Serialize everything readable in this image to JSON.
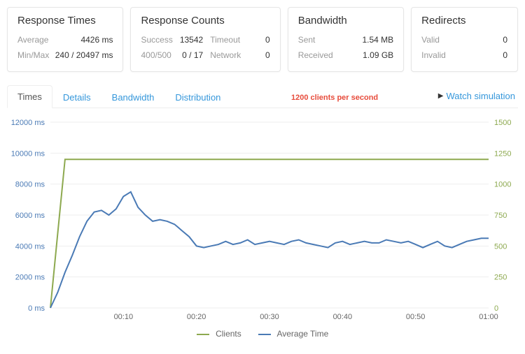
{
  "cards": {
    "response_times": {
      "title": "Response Times",
      "rows": [
        {
          "k": "Average",
          "v": "4426 ms"
        },
        {
          "k": "Min/Max",
          "v": "240 / 20497 ms"
        }
      ]
    },
    "response_counts": {
      "title": "Response Counts",
      "cells": {
        "success_k": "Success",
        "success_v": "13542",
        "timeout_k": "Timeout",
        "timeout_v": "0",
        "status_k": "400/500",
        "status_v": "0 / 17",
        "network_k": "Network",
        "network_v": "0"
      }
    },
    "bandwidth": {
      "title": "Bandwidth",
      "rows": [
        {
          "k": "Sent",
          "v": "1.54 MB"
        },
        {
          "k": "Received",
          "v": "1.09 GB"
        }
      ]
    },
    "redirects": {
      "title": "Redirects",
      "rows": [
        {
          "k": "Valid",
          "v": "0"
        },
        {
          "k": "Invalid",
          "v": "0"
        }
      ]
    }
  },
  "tabs": {
    "times": "Times",
    "details": "Details",
    "bandwidth": "Bandwidth",
    "distribution": "Distribution"
  },
  "banner": "1200 clients per second",
  "watch": "Watch simulation",
  "legend": {
    "clients": "Clients",
    "avg": "Average Time"
  },
  "chart_data": {
    "type": "line",
    "x_unit": "seconds",
    "x_ticks": [
      "00:10",
      "00:20",
      "00:30",
      "00:40",
      "00:50",
      "01:00"
    ],
    "left_axis": {
      "label": "ms",
      "ticks": [
        0,
        2000,
        4000,
        6000,
        8000,
        10000,
        12000
      ],
      "range": [
        0,
        12000
      ]
    },
    "right_axis": {
      "label": "",
      "ticks": [
        0,
        250,
        500,
        750,
        1000,
        1250,
        1500
      ],
      "range": [
        0,
        1500
      ]
    },
    "series": [
      {
        "name": "Clients",
        "axis": "right",
        "points": [
          {
            "x": 0,
            "y": 0
          },
          {
            "x": 1,
            "y": 600
          },
          {
            "x": 2,
            "y": 1200
          },
          {
            "x": 3,
            "y": 1200
          },
          {
            "x": 60,
            "y": 1200
          }
        ]
      },
      {
        "name": "Average Time",
        "axis": "left",
        "points": [
          {
            "x": 0,
            "y": 0
          },
          {
            "x": 1,
            "y": 1000
          },
          {
            "x": 2,
            "y": 2300
          },
          {
            "x": 3,
            "y": 3400
          },
          {
            "x": 4,
            "y": 4600
          },
          {
            "x": 5,
            "y": 5600
          },
          {
            "x": 6,
            "y": 6200
          },
          {
            "x": 7,
            "y": 6300
          },
          {
            "x": 8,
            "y": 6000
          },
          {
            "x": 9,
            "y": 6400
          },
          {
            "x": 10,
            "y": 7200
          },
          {
            "x": 11,
            "y": 7500
          },
          {
            "x": 12,
            "y": 6500
          },
          {
            "x": 13,
            "y": 6000
          },
          {
            "x": 14,
            "y": 5600
          },
          {
            "x": 15,
            "y": 5700
          },
          {
            "x": 16,
            "y": 5600
          },
          {
            "x": 17,
            "y": 5400
          },
          {
            "x": 18,
            "y": 5000
          },
          {
            "x": 19,
            "y": 4600
          },
          {
            "x": 20,
            "y": 4000
          },
          {
            "x": 21,
            "y": 3900
          },
          {
            "x": 22,
            "y": 4000
          },
          {
            "x": 23,
            "y": 4100
          },
          {
            "x": 24,
            "y": 4300
          },
          {
            "x": 25,
            "y": 4100
          },
          {
            "x": 26,
            "y": 4200
          },
          {
            "x": 27,
            "y": 4400
          },
          {
            "x": 28,
            "y": 4100
          },
          {
            "x": 29,
            "y": 4200
          },
          {
            "x": 30,
            "y": 4300
          },
          {
            "x": 31,
            "y": 4200
          },
          {
            "x": 32,
            "y": 4100
          },
          {
            "x": 33,
            "y": 4300
          },
          {
            "x": 34,
            "y": 4400
          },
          {
            "x": 35,
            "y": 4200
          },
          {
            "x": 36,
            "y": 4100
          },
          {
            "x": 37,
            "y": 4000
          },
          {
            "x": 38,
            "y": 3900
          },
          {
            "x": 39,
            "y": 4200
          },
          {
            "x": 40,
            "y": 4300
          },
          {
            "x": 41,
            "y": 4100
          },
          {
            "x": 42,
            "y": 4200
          },
          {
            "x": 43,
            "y": 4300
          },
          {
            "x": 44,
            "y": 4200
          },
          {
            "x": 45,
            "y": 4200
          },
          {
            "x": 46,
            "y": 4400
          },
          {
            "x": 47,
            "y": 4300
          },
          {
            "x": 48,
            "y": 4200
          },
          {
            "x": 49,
            "y": 4300
          },
          {
            "x": 50,
            "y": 4100
          },
          {
            "x": 51,
            "y": 3900
          },
          {
            "x": 52,
            "y": 4100
          },
          {
            "x": 53,
            "y": 4300
          },
          {
            "x": 54,
            "y": 4000
          },
          {
            "x": 55,
            "y": 3900
          },
          {
            "x": 56,
            "y": 4100
          },
          {
            "x": 57,
            "y": 4300
          },
          {
            "x": 58,
            "y": 4400
          },
          {
            "x": 59,
            "y": 4500
          },
          {
            "x": 60,
            "y": 4500
          }
        ]
      }
    ]
  }
}
